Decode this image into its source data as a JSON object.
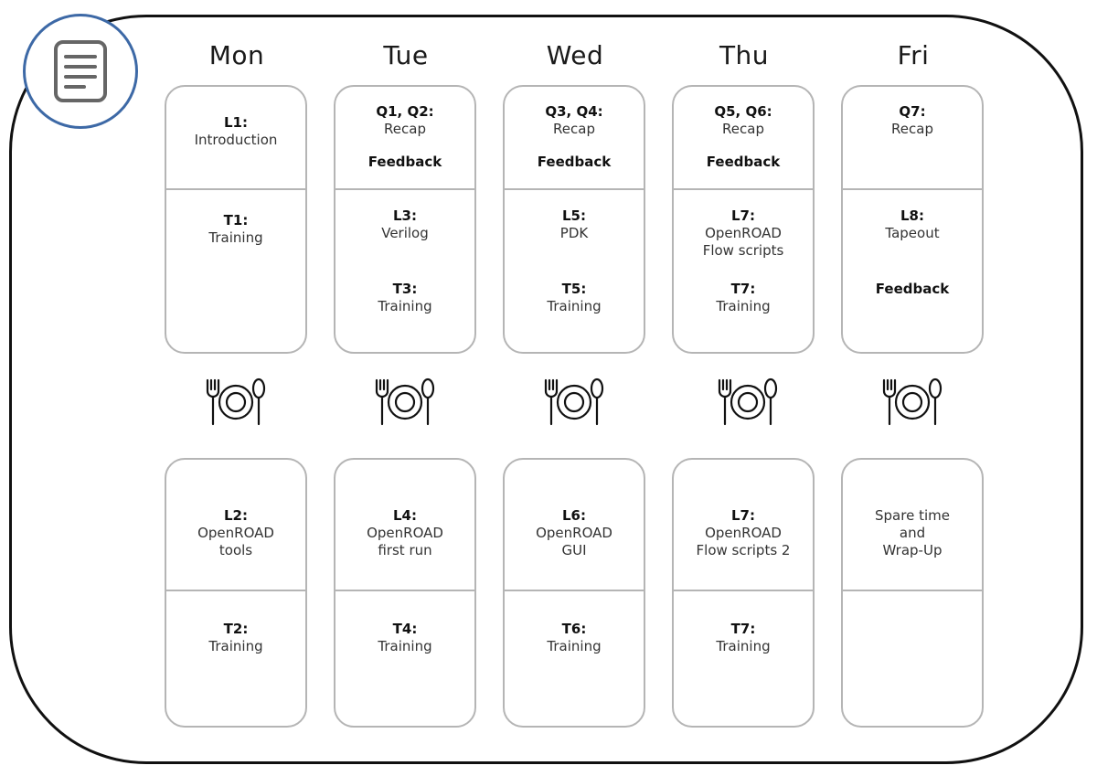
{
  "icons": {
    "badge": "document-icon",
    "meal": "plate-fork-spoon-icon"
  },
  "colors": {
    "badge_ring": "#3d69a6",
    "card_border": "#b5b5b5",
    "frame": "#111111"
  },
  "days": [
    {
      "name": "Mon",
      "morning": {
        "top": {
          "code": "L1:",
          "text": "Introduction"
        },
        "bottom": {
          "code": "T1:",
          "text": "Training"
        }
      },
      "afternoon": {
        "top": {
          "code": "L2:",
          "text": "OpenROAD\ntools"
        },
        "bottom": {
          "code": "T2:",
          "text": "Training"
        }
      }
    },
    {
      "name": "Tue",
      "morning": {
        "top": {
          "code": "Q1, Q2:",
          "text": "Recap",
          "feedback": "Feedback"
        },
        "bottom": {
          "code": "L3:",
          "text": "Verilog",
          "code2": "T3:",
          "text2": "Training"
        }
      },
      "afternoon": {
        "top": {
          "code": "L4:",
          "text": "OpenROAD\nfirst run"
        },
        "bottom": {
          "code": "T4:",
          "text": "Training"
        }
      }
    },
    {
      "name": "Wed",
      "morning": {
        "top": {
          "code": "Q3, Q4:",
          "text": "Recap",
          "feedback": "Feedback"
        },
        "bottom": {
          "code": "L5:",
          "text": "PDK",
          "code2": "T5:",
          "text2": "Training"
        }
      },
      "afternoon": {
        "top": {
          "code": "L6:",
          "text": "OpenROAD\nGUI"
        },
        "bottom": {
          "code": "T6:",
          "text": "Training"
        }
      }
    },
    {
      "name": "Thu",
      "morning": {
        "top": {
          "code": "Q5, Q6:",
          "text": "Recap",
          "feedback": "Feedback"
        },
        "bottom": {
          "code": "L7:",
          "text": "OpenROAD\nFlow scripts",
          "code2": "T7:",
          "text2": "Training"
        }
      },
      "afternoon": {
        "top": {
          "code": "L7:",
          "text": "OpenROAD\nFlow scripts 2"
        },
        "bottom": {
          "code": "T7:",
          "text": "Training"
        }
      }
    },
    {
      "name": "Fri",
      "morning": {
        "top": {
          "code": "Q7:",
          "text": "Recap"
        },
        "bottom": {
          "code": "L8:",
          "text": "Tapeout",
          "feedback": "Feedback"
        }
      },
      "afternoon": {
        "top": {
          "code": "",
          "text": "Spare time\nand\nWrap-Up"
        },
        "bottom": {
          "code": "",
          "text": ""
        }
      }
    }
  ]
}
